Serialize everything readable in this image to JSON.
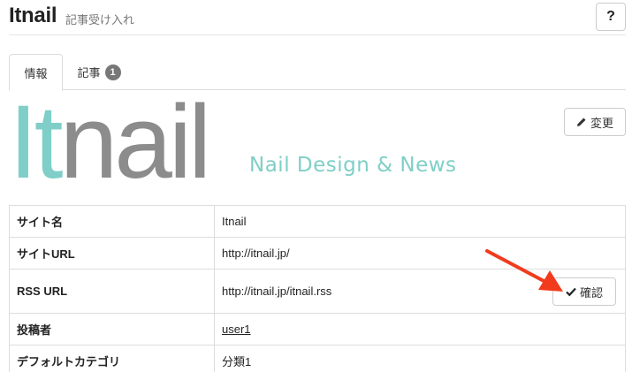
{
  "header": {
    "title": "Itnail",
    "subtitle": "記事受け入れ",
    "help_label": "?"
  },
  "tabs": [
    {
      "label": "情報",
      "active": true
    },
    {
      "label": "記事",
      "badge": "1",
      "active": false
    }
  ],
  "logo": {
    "part1": "It",
    "part2": "nail",
    "tagline": "Nail Design & News",
    "colors": {
      "accent": "#7fcfc8",
      "gray": "#8c8c8c"
    }
  },
  "edit_button": {
    "icon": "pencil-icon",
    "label": "変更"
  },
  "details": [
    {
      "key": "サイト名",
      "value": "Itnail"
    },
    {
      "key": "サイトURL",
      "value": "http://itnail.jp/"
    },
    {
      "key": "RSS URL",
      "value": "http://itnail.jp/itnail.rss",
      "button": {
        "icon": "check-icon",
        "label": "確認"
      }
    },
    {
      "key": "投稿者",
      "value": "user1"
    },
    {
      "key": "デフォルトカテゴリ",
      "value": "分類1"
    }
  ],
  "annotation": {
    "arrow_color": "#f23b1c"
  }
}
